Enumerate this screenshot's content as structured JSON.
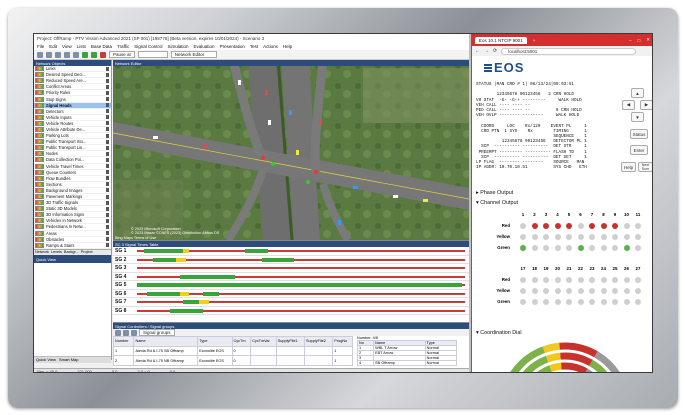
{
  "vissim": {
    "title": "Project: OffRamp - PTV Vissim Advanced 2021 (SP 001) [198778] (Beta version, expires 10/01/2024) - Scenario 3",
    "menu": [
      "File",
      "Edit",
      "View",
      "Lists",
      "Base Data",
      "Traffic",
      "Signal Control",
      "Simulation",
      "Evaluation",
      "Presentation",
      "Test",
      "Actions",
      "Help"
    ],
    "pause_label": "Pause at",
    "network_editor_label": "Network Editor",
    "left_panel_title": "Network Objects",
    "network_objects": [
      {
        "label": "Links",
        "selected": false
      },
      {
        "label": "Desired Speed Deci...",
        "selected": false
      },
      {
        "label": "Reduced Speed Are...",
        "selected": false
      },
      {
        "label": "Conflict Areas",
        "selected": false
      },
      {
        "label": "Priority Rules",
        "selected": false
      },
      {
        "label": "Stop Signs",
        "selected": false
      },
      {
        "label": "Signal Heads",
        "selected": true
      },
      {
        "label": "Detectors",
        "selected": false
      },
      {
        "label": "Vehicle Inputs",
        "selected": false
      },
      {
        "label": "Vehicle Routes",
        "selected": false
      },
      {
        "label": "Vehicle Attribute De...",
        "selected": false
      },
      {
        "label": "Parking Lots",
        "selected": false
      },
      {
        "label": "Public Transport Sto...",
        "selected": false
      },
      {
        "label": "Public Transport Lin...",
        "selected": false
      },
      {
        "label": "Nodes",
        "selected": false
      },
      {
        "label": "Data Collection Poi...",
        "selected": false
      },
      {
        "label": "Vehicle Travel Times",
        "selected": false
      },
      {
        "label": "Queue Counters",
        "selected": false
      },
      {
        "label": "Flow Bundles",
        "selected": false
      },
      {
        "label": "Sections",
        "selected": false
      },
      {
        "label": "Background Images",
        "selected": false
      },
      {
        "label": "Pavement Markings",
        "selected": false
      },
      {
        "label": "3D Traffic Signals",
        "selected": false
      },
      {
        "label": "Static 3D Models",
        "selected": false
      },
      {
        "label": "3D Information Signs",
        "selected": false
      },
      {
        "label": "Vehicles In Network",
        "selected": false
      },
      {
        "label": "Pedestrians In Netw...",
        "selected": false
      },
      {
        "label": "Areas",
        "selected": false
      },
      {
        "label": "Obstacles",
        "selected": false
      },
      {
        "label": "Ramps & Stairs",
        "selected": false
      }
    ],
    "left_tabs": [
      "Network",
      "Levels",
      "Backgr...",
      "Project"
    ],
    "quick_view_label": "Quick View",
    "bottom_tabs": [
      "Quick View",
      "Smart Map"
    ],
    "net_view_title": "Network Editor",
    "sig_view_title": "SC 3 Signal Times Table",
    "signal_groups": [
      {
        "label": "SG 1",
        "segments": [
          {
            "kind": "g",
            "from": 0.02,
            "to": 0.14
          },
          {
            "kind": "y",
            "from": 0.14,
            "to": 0.16
          },
          {
            "kind": "g",
            "from": 0.33,
            "to": 0.4
          }
        ]
      },
      {
        "label": "SG 2",
        "segments": [
          {
            "kind": "g",
            "from": 0.05,
            "to": 0.12
          },
          {
            "kind": "y",
            "from": 0.12,
            "to": 0.15
          },
          {
            "kind": "g",
            "from": 0.38,
            "to": 0.48
          }
        ]
      },
      {
        "label": "SG 3",
        "segments": []
      },
      {
        "label": "SG 4",
        "segments": [
          {
            "kind": "g",
            "from": 0.13,
            "to": 0.3
          }
        ]
      },
      {
        "label": "SG 5",
        "segments": [
          {
            "kind": "g",
            "from": 0.0,
            "to": 0.99
          }
        ]
      },
      {
        "label": "SG 6",
        "segments": [
          {
            "kind": "g",
            "from": 0.03,
            "to": 0.13
          },
          {
            "kind": "y",
            "from": 0.13,
            "to": 0.16
          },
          {
            "kind": "g",
            "from": 0.2,
            "to": 0.25
          }
        ]
      },
      {
        "label": "SG 7",
        "segments": [
          {
            "kind": "g",
            "from": 0.14,
            "to": 0.19
          },
          {
            "kind": "y",
            "from": 0.19,
            "to": 0.22
          }
        ]
      },
      {
        "label": "SG 8",
        "segments": [
          {
            "kind": "g",
            "from": 0.1,
            "to": 0.2
          }
        ]
      }
    ],
    "sc_table_title": "Signal Controllers / Signal groups",
    "sc_selector": "Signal groups",
    "sc_headers": [
      "Number",
      "Name",
      "Type",
      "CycTm",
      "CycTmVar",
      "SupplyFile1",
      "SupplyFile2",
      "ProgNo"
    ],
    "sc_rows": [
      [
        "1",
        "Alexia Rd & I-75 SB Offramp",
        "Econolite EOS",
        "0",
        "",
        "",
        "",
        "1"
      ],
      [
        "2",
        "Alexia Rd & I-75 NB Offramp",
        "Econolite EOS",
        "0",
        "",
        "",
        "",
        "1"
      ]
    ],
    "sg_headers": [
      "No",
      "Name",
      "Type"
    ],
    "sg_rows": [
      [
        "1",
        "WBL T Arrow",
        "Normal"
      ],
      [
        "2",
        "EBT Arrow",
        "Normal"
      ],
      [
        "3",
        "",
        "Normal"
      ],
      [
        "4",
        "SB Offramp",
        "Normal"
      ]
    ],
    "sg_count_label": "Number: 4/8",
    "status": [
      "Sim. = 45.0",
      "221.000",
      "0.0",
      "2.0 = 0",
      "0.0"
    ],
    "map_copyright": "© 2023 Microsoft Corporation\n© 2023 Maxar ©CNES (2023) Distribution Airbus DS",
    "map_terms": "Bing Maps  Terms of Use"
  },
  "browser": {
    "tab_label": "Eos 10.1 NTCIP 9001",
    "tab_add": "+",
    "window_controls": [
      "–",
      "□",
      "✕"
    ],
    "address": "localhost:5001",
    "brand": "EOS",
    "status_text": "STATUS |MAN CRD # 1| 06/13/24|09:03:51\n\n        12345678 90123456   2 CRN HOLD\nVH STAT  -G- -G-+ ---------     WALK HOLD\nVEH CALL ---- ---- --\nPED CALL ---- ---- --          6 CRN HOLD\nVEH OVLP -------- --------     WALK HOLD\n\n  COORD     LOC    Rx/120    EVENT PL     1\n  CRD PTN  1 SYS    Rx        TIMING      1\n                              SEQUENCE    1\n          12345678 90123456   DETECTOR PL 1\n  SCP  ---------- ----------  DET STR     1\n PREEMPT --------- ---------- FLASH TD    1\n  SCP  ---------- ----------  DET SET     1\nLP FLAG  -------- --------    SOURCE   MAN\nIP ADDR: 10.70.10.51          SYS CHD   ETH",
    "keys": {
      "up": "▲",
      "down": "▼",
      "left": "◀",
      "right": "▶",
      "status": "Status",
      "enter": "Enter",
      "help": "Help",
      "next": "Next Scrn"
    },
    "phase_output": "Phase Output",
    "channel_output": "Channel Output",
    "coordination_dial": "Coordination Dial",
    "expander": "▸",
    "expander_open": "▾",
    "channel_numbers_a": [
      "1",
      "2",
      "3",
      "4",
      "5",
      "6",
      "7",
      "8",
      "9",
      "10",
      "11"
    ],
    "channel_numbers_b": [
      "17",
      "18",
      "19",
      "20",
      "21",
      "22",
      "23",
      "24",
      "25",
      "26",
      "27"
    ],
    "row_labels": [
      "Red",
      "Yellow",
      "Green"
    ],
    "grid_a": {
      "red": [
        0,
        1,
        1,
        1,
        1,
        0,
        1,
        1,
        1,
        0,
        0
      ],
      "yellow": [
        0,
        0,
        0,
        0,
        0,
        0,
        0,
        0,
        0,
        0,
        0
      ],
      "green": [
        1,
        0,
        0,
        0,
        0,
        1,
        0,
        0,
        0,
        1,
        0
      ]
    },
    "grid_b": {
      "red": [
        0,
        0,
        0,
        0,
        0,
        0,
        0,
        0,
        0,
        0,
        0
      ],
      "yellow": [
        0,
        0,
        0,
        0,
        0,
        0,
        0,
        0,
        0,
        0,
        0
      ],
      "green": [
        0,
        0,
        0,
        0,
        0,
        0,
        0,
        0,
        0,
        0,
        0
      ]
    },
    "colors": {
      "red": "#c7322d",
      "green": "#5ab34a",
      "off": "#cfcfcf",
      "dial_green": "#7db24a",
      "dial_yellow": "#f2c81e",
      "dial_red": "#c7322d",
      "dial_grey": "#9a9a9a"
    }
  }
}
